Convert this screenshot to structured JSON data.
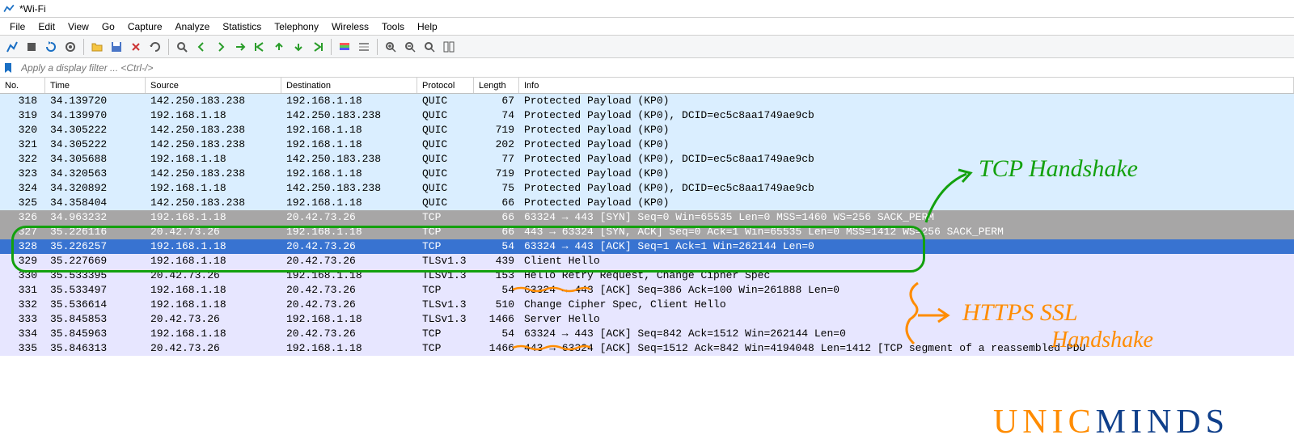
{
  "title": "*Wi-Fi",
  "menu": [
    "File",
    "Edit",
    "View",
    "Go",
    "Capture",
    "Analyze",
    "Statistics",
    "Telephony",
    "Wireless",
    "Tools",
    "Help"
  ],
  "filter_placeholder": "Apply a display filter ... <Ctrl-/>",
  "columns": {
    "no": "No.",
    "time": "Time",
    "source": "Source",
    "destination": "Destination",
    "protocol": "Protocol",
    "length": "Length",
    "info": "Info"
  },
  "rows": [
    {
      "no": "318",
      "time": "34.139720",
      "src": "142.250.183.238",
      "dst": "192.168.1.18",
      "proto": "QUIC",
      "len": "67",
      "info": "Protected Payload (KP0)",
      "cls": "quic"
    },
    {
      "no": "319",
      "time": "34.139970",
      "src": "192.168.1.18",
      "dst": "142.250.183.238",
      "proto": "QUIC",
      "len": "74",
      "info": "Protected Payload (KP0), DCID=ec5c8aa1749ae9cb",
      "cls": "quic"
    },
    {
      "no": "320",
      "time": "34.305222",
      "src": "142.250.183.238",
      "dst": "192.168.1.18",
      "proto": "QUIC",
      "len": "719",
      "info": "Protected Payload (KP0)",
      "cls": "quic"
    },
    {
      "no": "321",
      "time": "34.305222",
      "src": "142.250.183.238",
      "dst": "192.168.1.18",
      "proto": "QUIC",
      "len": "202",
      "info": "Protected Payload (KP0)",
      "cls": "quic"
    },
    {
      "no": "322",
      "time": "34.305688",
      "src": "192.168.1.18",
      "dst": "142.250.183.238",
      "proto": "QUIC",
      "len": "77",
      "info": "Protected Payload (KP0), DCID=ec5c8aa1749ae9cb",
      "cls": "quic"
    },
    {
      "no": "323",
      "time": "34.320563",
      "src": "142.250.183.238",
      "dst": "192.168.1.18",
      "proto": "QUIC",
      "len": "719",
      "info": "Protected Payload (KP0)",
      "cls": "quic"
    },
    {
      "no": "324",
      "time": "34.320892",
      "src": "192.168.1.18",
      "dst": "142.250.183.238",
      "proto": "QUIC",
      "len": "75",
      "info": "Protected Payload (KP0), DCID=ec5c8aa1749ae9cb",
      "cls": "quic"
    },
    {
      "no": "325",
      "time": "34.358404",
      "src": "142.250.183.238",
      "dst": "192.168.1.18",
      "proto": "QUIC",
      "len": "66",
      "info": "Protected Payload (KP0)",
      "cls": "quic"
    },
    {
      "no": "326",
      "time": "34.963232",
      "src": "192.168.1.18",
      "dst": "20.42.73.26",
      "proto": "TCP",
      "len": "66",
      "info": "63324 → 443 [SYN] Seq=0 Win=65535 Len=0 MSS=1460 WS=256 SACK_PERM",
      "cls": "tcp-syn"
    },
    {
      "no": "327",
      "time": "35.226116",
      "src": "20.42.73.26",
      "dst": "192.168.1.18",
      "proto": "TCP",
      "len": "66",
      "info": "443 → 63324 [SYN, ACK] Seq=0 Ack=1 Win=65535 Len=0 MSS=1412 WS=256 SACK_PERM",
      "cls": "tcp-syn"
    },
    {
      "no": "328",
      "time": "35.226257",
      "src": "192.168.1.18",
      "dst": "20.42.73.26",
      "proto": "TCP",
      "len": "54",
      "info": "63324 → 443 [ACK] Seq=1 Ack=1 Win=262144 Len=0",
      "cls": "selected"
    },
    {
      "no": "329",
      "time": "35.227669",
      "src": "192.168.1.18",
      "dst": "20.42.73.26",
      "proto": "TLSv1.3",
      "len": "439",
      "info": "Client Hello",
      "cls": "tls"
    },
    {
      "no": "330",
      "time": "35.533395",
      "src": "20.42.73.26",
      "dst": "192.168.1.18",
      "proto": "TLSv1.3",
      "len": "153",
      "info": "Hello Retry Request, Change Cipher Spec",
      "cls": "tls"
    },
    {
      "no": "331",
      "time": "35.533497",
      "src": "192.168.1.18",
      "dst": "20.42.73.26",
      "proto": "TCP",
      "len": "54",
      "info": "63324 → 443 [ACK] Seq=386 Ack=100 Win=261888 Len=0",
      "cls": "tcp"
    },
    {
      "no": "332",
      "time": "35.536614",
      "src": "192.168.1.18",
      "dst": "20.42.73.26",
      "proto": "TLSv1.3",
      "len": "510",
      "info": "Change Cipher Spec, Client Hello",
      "cls": "tls"
    },
    {
      "no": "333",
      "time": "35.845853",
      "src": "20.42.73.26",
      "dst": "192.168.1.18",
      "proto": "TLSv1.3",
      "len": "1466",
      "info": "Server Hello",
      "cls": "tls"
    },
    {
      "no": "334",
      "time": "35.845963",
      "src": "192.168.1.18",
      "dst": "20.42.73.26",
      "proto": "TCP",
      "len": "54",
      "info": "63324 → 443 [ACK] Seq=842 Ack=1512 Win=262144 Len=0",
      "cls": "tcp"
    },
    {
      "no": "335",
      "time": "35.846313",
      "src": "20.42.73.26",
      "dst": "192.168.1.18",
      "proto": "TCP",
      "len": "1466",
      "info": "443 → 63324 [ACK] Seq=1512 Ack=842 Win=4194048 Len=1412 [TCP segment of a reassembled PDU",
      "cls": "tcp"
    }
  ],
  "annotations": {
    "tcp": "TCP Handshake",
    "https1": "HTTPS SSL",
    "https2": "Handshake"
  },
  "watermark": {
    "p1": "UNIC",
    "p2": "MINDS"
  }
}
